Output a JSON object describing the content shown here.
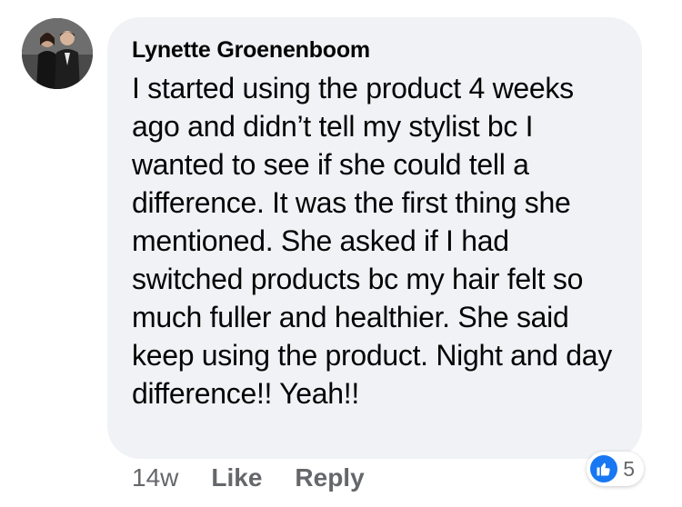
{
  "comment": {
    "author": "Lynette Groenenboom",
    "text": "I started using the product 4 weeks ago and didn’t tell my stylist bc I wanted to see if she could tell a difference. It was the first thing she mentioned. She asked if I had switched products bc my hair felt so much fuller and healthier. She said keep using the product. Night and day difference!! Yeah!!",
    "avatar_icon": "profile-photo",
    "bubble_color": "#f0f2f5"
  },
  "actions": {
    "timestamp": "14w",
    "like_label": "Like",
    "reply_label": "Reply"
  },
  "reactions": {
    "icon": "thumbs-up-icon",
    "count": "5",
    "color": "#1877f2"
  }
}
